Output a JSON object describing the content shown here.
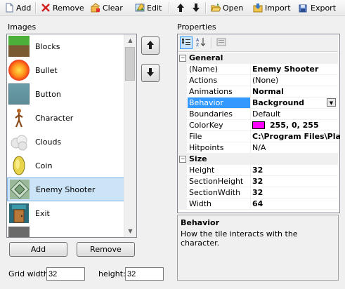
{
  "toolbar": {
    "add": "Add",
    "remove": "Remove",
    "clear": "Clear",
    "edit": "Edit",
    "open": "Open",
    "import": "Import",
    "export": "Export"
  },
  "images_group": {
    "title": "Images"
  },
  "images": [
    {
      "label": "Blocks"
    },
    {
      "label": "Bullet"
    },
    {
      "label": "Button"
    },
    {
      "label": "Character"
    },
    {
      "label": "Clouds"
    },
    {
      "label": "Coin"
    },
    {
      "label": "Enemy Shooter"
    },
    {
      "label": "Exit"
    }
  ],
  "list_buttons": {
    "add": "Add",
    "remove": "Remove"
  },
  "grid": {
    "width_label": "Grid width:",
    "width_value": "32",
    "height_label": "height:",
    "height_value": "32"
  },
  "properties_group": {
    "title": "Properties"
  },
  "property_grid": {
    "categories": {
      "general": "General",
      "size": "Size"
    },
    "general_rows": [
      {
        "name": "(Name)",
        "value": "Enemy Shooter"
      },
      {
        "name": "Actions",
        "value": "(None)"
      },
      {
        "name": "Animations",
        "value": "Normal"
      },
      {
        "name": "Behavior",
        "value": "Background"
      },
      {
        "name": "Boundaries",
        "value": "Default"
      },
      {
        "name": "ColorKey",
        "value": "255, 0, 255"
      },
      {
        "name": "File",
        "value": "C:\\Program Files\\Plat"
      },
      {
        "name": "Hitpoints",
        "value": "N/A"
      }
    ],
    "size_rows": [
      {
        "name": "Height",
        "value": "32"
      },
      {
        "name": "SectionHeight",
        "value": "32"
      },
      {
        "name": "SectionWdith",
        "value": "32"
      },
      {
        "name": "Width",
        "value": "64"
      }
    ],
    "colorkey_swatch": "#ff00ff"
  },
  "description": {
    "title": "Behavior",
    "text": "How the tile interacts with the character."
  },
  "colors": {
    "selection": "#3399ff",
    "list_selection": "#cce4f7"
  }
}
